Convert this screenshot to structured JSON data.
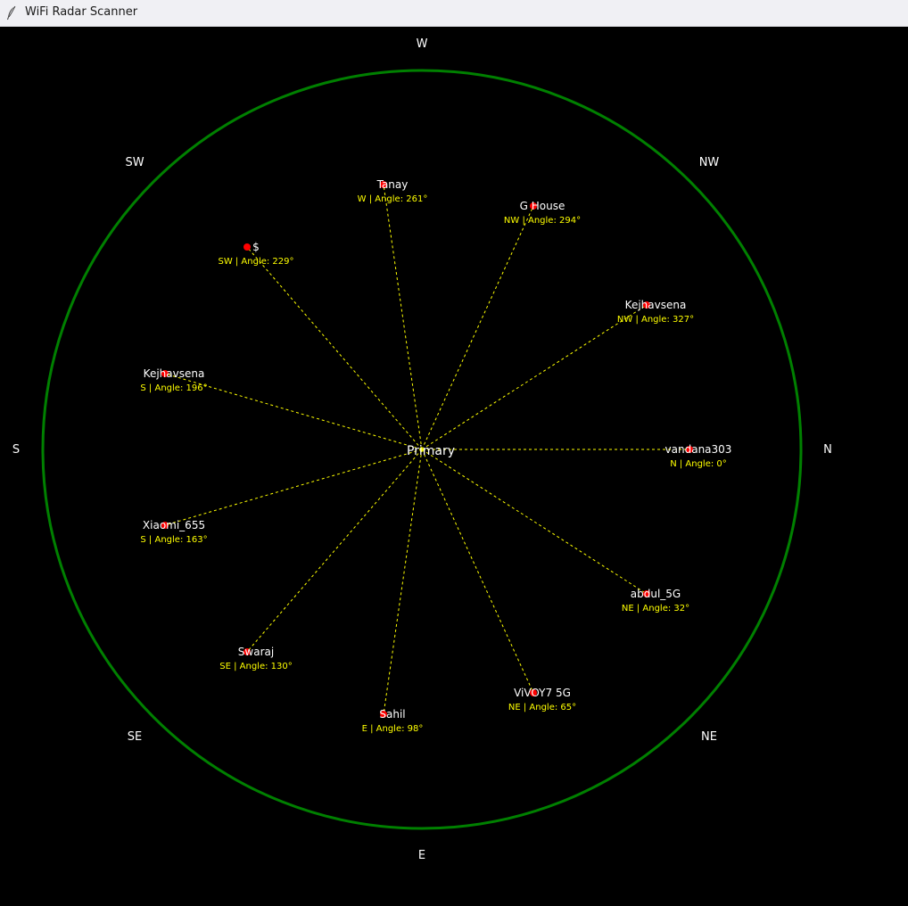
{
  "window": {
    "title": "WiFi Radar Scanner",
    "icon": "feather-icon"
  },
  "radar": {
    "center_label": "Primary",
    "ring_color": "#008000",
    "line_color": "#ffff00",
    "dot_color": "#ff0000",
    "directions": [
      {
        "name": "w",
        "label": "W"
      },
      {
        "name": "nw",
        "label": "NW"
      },
      {
        "name": "n",
        "label": "N"
      },
      {
        "name": "ne",
        "label": "NE"
      },
      {
        "name": "e",
        "label": "E"
      },
      {
        "name": "se",
        "label": "SE"
      },
      {
        "name": "s",
        "label": "S"
      },
      {
        "name": "sw",
        "label": "SW"
      }
    ],
    "networks": [
      {
        "ssid": "vandana303",
        "info": "N | Angle: 0°"
      },
      {
        "ssid": "abdul_5G",
        "info": "NE | Angle: 32°"
      },
      {
        "ssid": "ViVOY7 5G",
        "info": "NE | Angle: 65°"
      },
      {
        "ssid": "Sahil",
        "info": "E | Angle: 98°"
      },
      {
        "ssid": "Swaraj",
        "info": "SE | Angle: 130°"
      },
      {
        "ssid": "Xiaomi_655",
        "info": "S | Angle: 163°"
      },
      {
        "ssid": "Kejhavsena",
        "info": "S | Angle: 196°"
      },
      {
        "ssid": "$",
        "info": "SW | Angle: 229°"
      },
      {
        "ssid": "Tanay",
        "info": "W | Angle: 261°"
      },
      {
        "ssid": "G House",
        "info": "NW | Angle: 294°"
      },
      {
        "ssid": "Kejhavsena",
        "info": "NW | Angle: 327°"
      }
    ]
  }
}
